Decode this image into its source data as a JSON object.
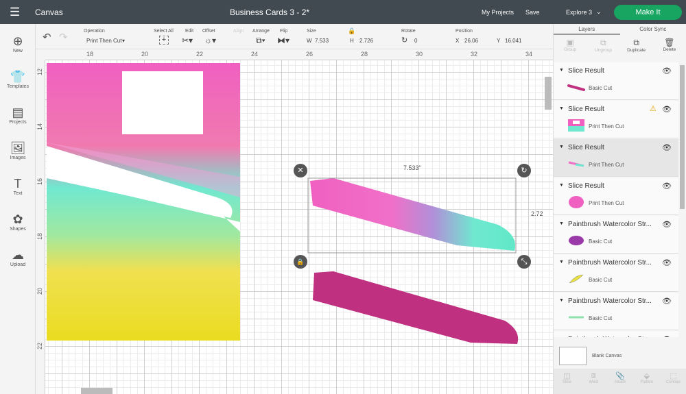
{
  "topbar": {
    "menu_icon": "hamburger-icon",
    "app": "Canvas",
    "title": "Business Cards 3 - 2*",
    "my_projects": "My Projects",
    "save": "Save",
    "machine": "Explore 3",
    "make_it": "Make It"
  },
  "sidebar": [
    {
      "label": "New",
      "icon": "plus-circle-icon"
    },
    {
      "label": "Templates",
      "icon": "shirt-icon"
    },
    {
      "label": "Projects",
      "icon": "projects-icon"
    },
    {
      "label": "Images",
      "icon": "image-icon"
    },
    {
      "label": "Text",
      "icon": "text-icon"
    },
    {
      "label": "Shapes",
      "icon": "shapes-icon"
    },
    {
      "label": "Upload",
      "icon": "cloud-upload-icon"
    }
  ],
  "toolbar": {
    "operation_label": "Operation",
    "operation_value": "Print Then Cut",
    "select_all": "Select All",
    "edit": "Edit",
    "offset": "Offset",
    "align": "Align",
    "arrange": "Arrange",
    "flip": "Flip",
    "size": "Size",
    "w_label": "W",
    "w": "7.533",
    "h_label": "H",
    "h": "2.726",
    "rotate": "Rotate",
    "rotate_value": "0",
    "position": "Position",
    "x_label": "X",
    "x": "26.06",
    "y_label": "Y",
    "y": "16.041"
  },
  "ruler": {
    "top": [
      "18",
      "20",
      "22",
      "24",
      "26",
      "28",
      "30",
      "32",
      "34"
    ],
    "left": [
      "12",
      "14",
      "16",
      "18",
      "20",
      "22"
    ]
  },
  "canvas": {
    "width_label": "7.533\"",
    "height_label": "2.72"
  },
  "panel": {
    "tabs": [
      "Layers",
      "Color Sync"
    ],
    "actions": [
      "Group",
      "Ungroup",
      "Duplicate",
      "Delete"
    ],
    "layers": [
      {
        "name": "Slice Result",
        "type": "Basic Cut",
        "warning": false,
        "selected": false
      },
      {
        "name": "Slice Result",
        "type": "Print Then Cut",
        "warning": true,
        "selected": false
      },
      {
        "name": "Slice Result",
        "type": "Print Then Cut",
        "warning": false,
        "selected": true
      },
      {
        "name": "Slice Result",
        "type": "Print Then Cut",
        "warning": false,
        "selected": false
      },
      {
        "name": "Paintbrush Watercolor Str...",
        "type": "Basic Cut",
        "warning": false,
        "selected": false
      },
      {
        "name": "Paintbrush Watercolor Str...",
        "type": "Basic Cut",
        "warning": false,
        "selected": false
      },
      {
        "name": "Paintbrush Watercolor Str...",
        "type": "Basic Cut",
        "warning": false,
        "selected": false
      },
      {
        "name": "Paintbrush Watercolor Str...",
        "type": "",
        "warning": false,
        "selected": false
      }
    ],
    "blank_canvas": "Blank Canvas",
    "bottom_actions": [
      "Slice",
      "Weld",
      "Attach",
      "Flatten",
      "Contour"
    ]
  },
  "colors": {
    "make_it": "#17a561",
    "topbar": "#414a50",
    "magenta_stroke": "#c03080"
  }
}
